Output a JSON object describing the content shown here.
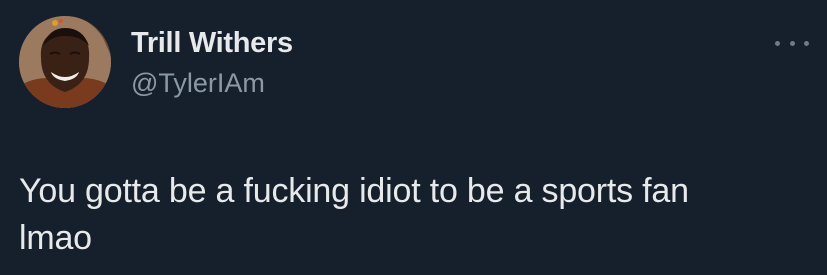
{
  "author": {
    "display_name": "Trill Withers",
    "handle": "@TylerIAm",
    "avatar_icon": "profile-photo"
  },
  "menu": {
    "icon": "more-options-icon"
  },
  "tweet": {
    "line1": "You gotta be a fucking idiot to be a sports fan",
    "line2": "lmao"
  },
  "colors": {
    "background": "#16202c",
    "text_primary": "#e7e9ea",
    "text_secondary": "#8b98a5"
  }
}
